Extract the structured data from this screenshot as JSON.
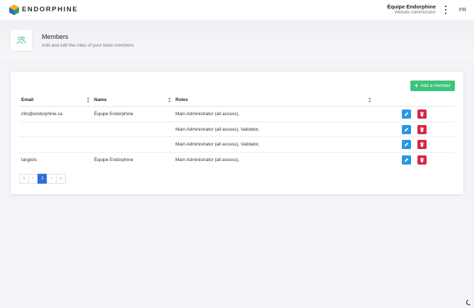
{
  "app": {
    "brand": "ENDORPHINE"
  },
  "user": {
    "name": "Équipe Endorphine",
    "role": "Website Administrator"
  },
  "language": "FR",
  "page": {
    "title": "Members",
    "subtitle": "Add and edit the roles of your team members"
  },
  "toolbar": {
    "add_member_label": "Add a member"
  },
  "table": {
    "headers": {
      "email": "Email",
      "name": "Name",
      "roles": "Roles"
    },
    "rows": [
      {
        "email": "info@endorphine.ca",
        "name": "Équipe Endorphine",
        "roles": "Main Administrator (all access),"
      },
      {
        "email": "",
        "name": "",
        "roles": "Main Administrator (all access), Validator,"
      },
      {
        "email": "",
        "name": "",
        "roles": "Main Administrator (all access), Validator,"
      },
      {
        "email": "langlois",
        "name": "Équipe Endorphine",
        "roles": "Main Administrator (all access),"
      }
    ]
  },
  "pagination": {
    "first": "«",
    "prev": "‹",
    "current": "1",
    "next": "›",
    "last": "»"
  },
  "icons": {
    "logo": "endorphine-logo-icon",
    "kebab": "kebab-menu-icon",
    "members": "members-icon",
    "add": "plus-icon",
    "edit": "pencil-icon",
    "delete": "trash-icon",
    "sort": "sort-icon",
    "loading": "loading-spinner-icon"
  },
  "colors": {
    "add_button": "#3cc47c",
    "edit_button": "#2b96e3",
    "delete_button": "#d8264a",
    "pagination_active": "#2f6fd8"
  }
}
